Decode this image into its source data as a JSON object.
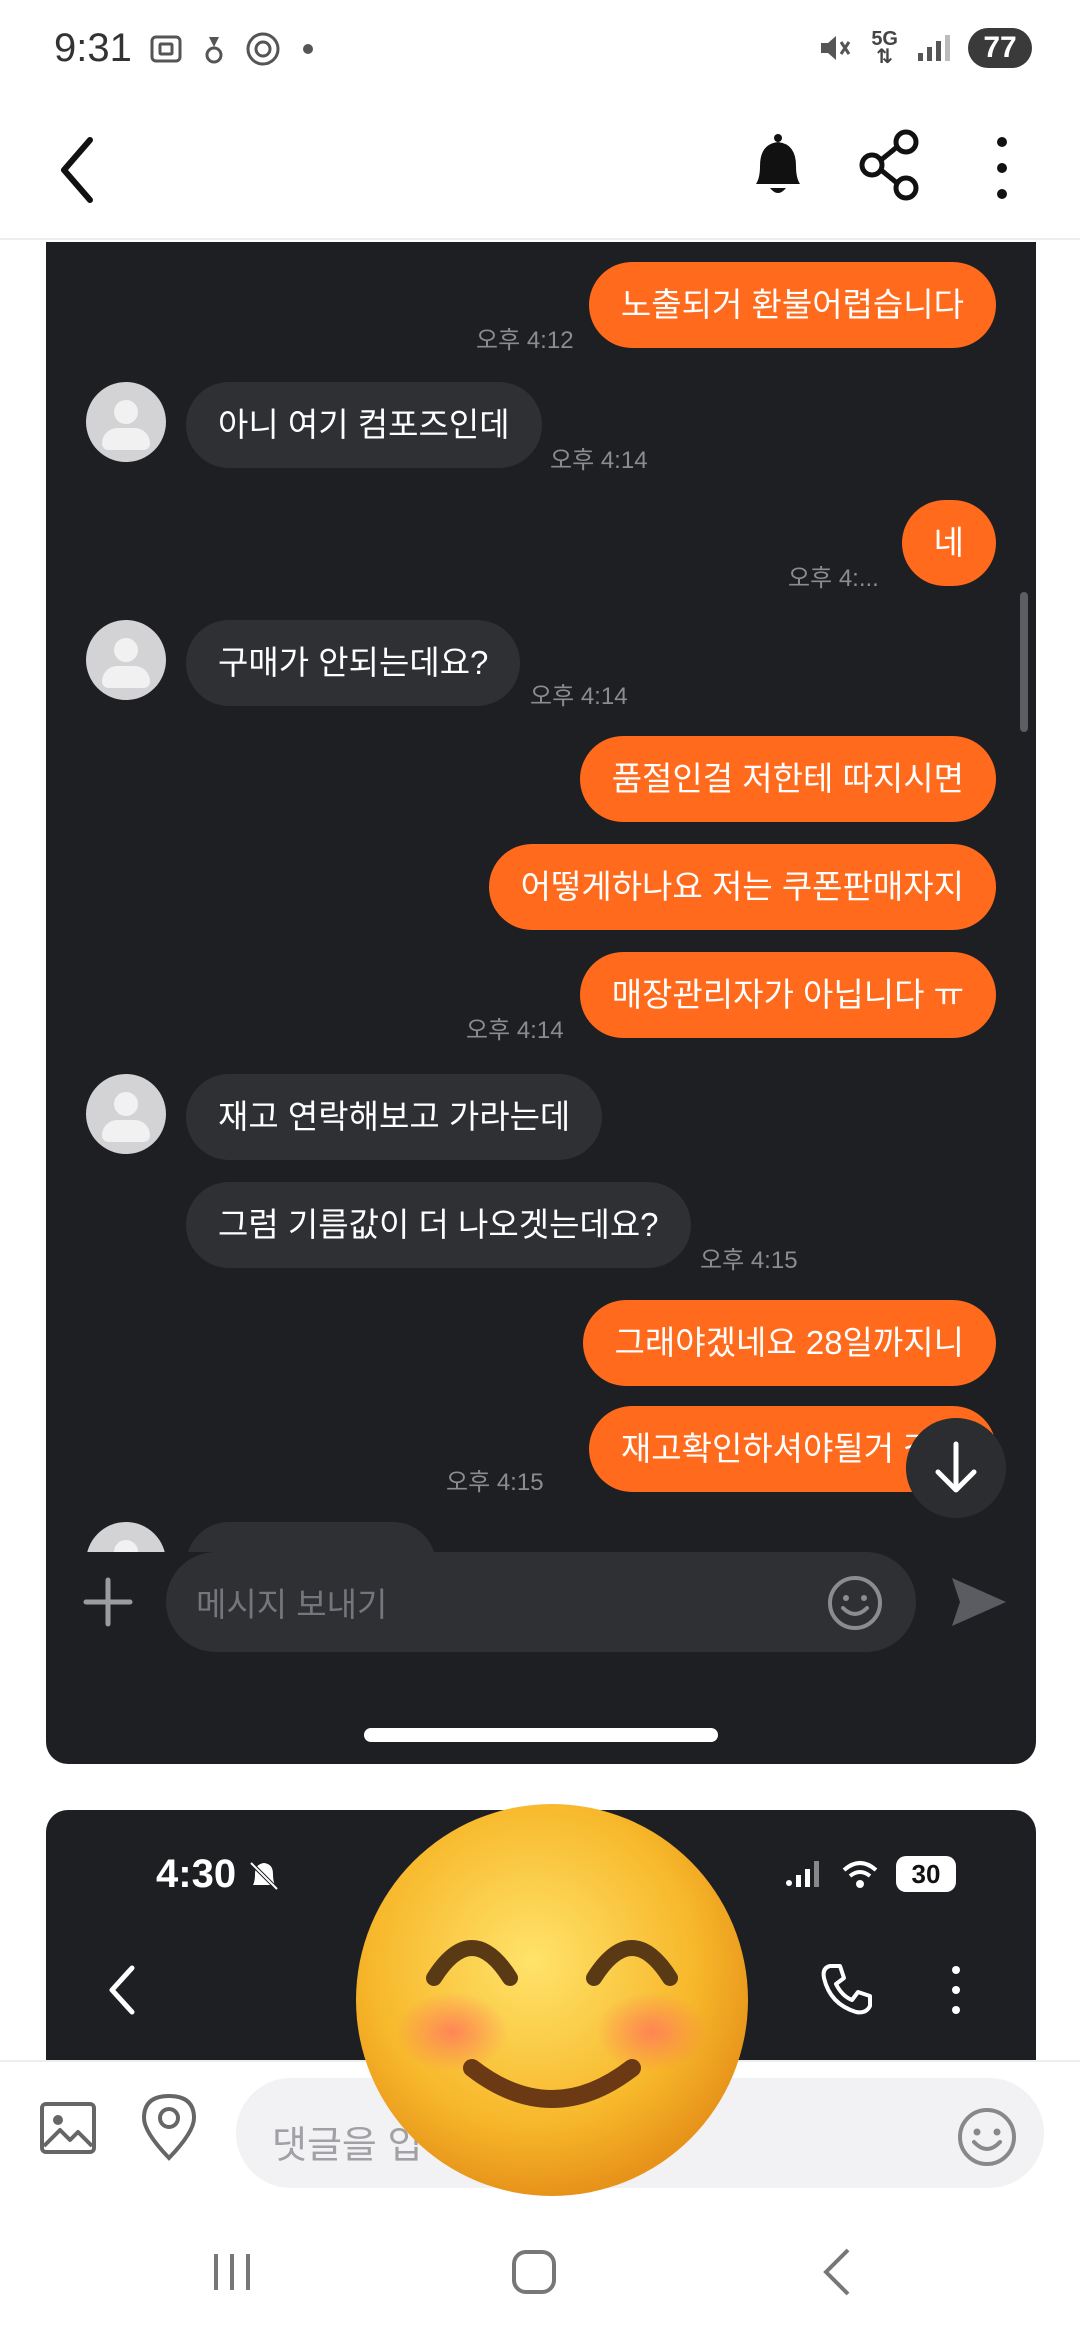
{
  "status_bar": {
    "time": "9:31",
    "network": "5G",
    "battery": "77"
  },
  "header": {
    "back_icon": "chevron-left-icon",
    "notification_icon": "bell-icon",
    "share_icon": "share-icon",
    "more_icon": "more-vertical-icon"
  },
  "chat": {
    "accent_color": "#ff6a1c",
    "messages": [
      {
        "side": "mine",
        "text": "노출되거 환불어렵습니다",
        "time": "오후 4:12"
      },
      {
        "side": "theirs",
        "text": "아니 여기 컴포즈인데",
        "time": "오후 4:14"
      },
      {
        "side": "mine",
        "text": "네",
        "time": "오후 4:..."
      },
      {
        "side": "theirs",
        "text": "구매가 안되는데요?",
        "time": "오후 4:14"
      },
      {
        "side": "mine",
        "text": "품절인걸 저한테 따지시면",
        "time": ""
      },
      {
        "side": "mine",
        "text": "어떻게하나요 저는 쿠폰판매자지",
        "time": ""
      },
      {
        "side": "mine",
        "text": "매장관리자가 아닙니다 ㅠ",
        "time": "오후 4:14"
      },
      {
        "side": "theirs",
        "text": "재고 연락해보고 가라는데",
        "time": ""
      },
      {
        "side": "theirs",
        "text": "그럼 기름값이 더 나오겟는데요?",
        "time": "오후 4:15"
      },
      {
        "side": "mine",
        "text": "그래야겠네요 28일까지니",
        "time": ""
      },
      {
        "side": "mine",
        "text": "재고확인하셔야될거 같아",
        "time": "오후 4:15"
      }
    ],
    "input_placeholder": "메시지 보내기"
  },
  "second_screenshot": {
    "time": "4:30",
    "battery": "30"
  },
  "sticker": {
    "icon": "smiling-face-emoji"
  },
  "comment_bar": {
    "placeholder": "댓글을 입"
  },
  "nav": {
    "recent": "recent-apps-icon",
    "home": "home-icon",
    "back": "back-icon"
  }
}
